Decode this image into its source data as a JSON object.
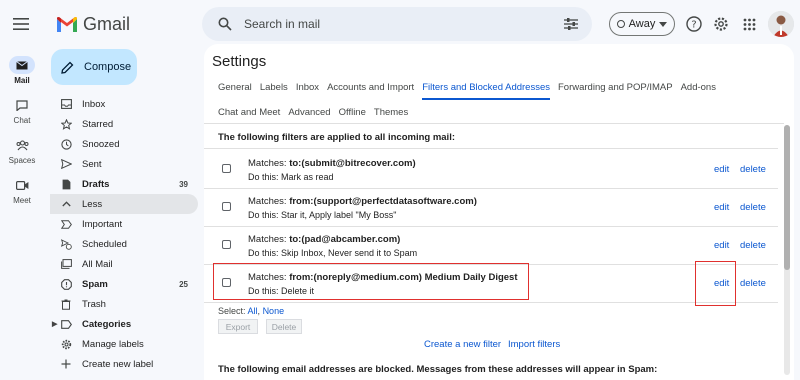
{
  "header": {
    "brand": "Gmail",
    "search_placeholder": "Search in mail",
    "status": "Away"
  },
  "rail": [
    {
      "label": "Mail",
      "icon": "mail-icon"
    },
    {
      "label": "Chat",
      "icon": "chat-icon"
    },
    {
      "label": "Spaces",
      "icon": "spaces-icon"
    },
    {
      "label": "Meet",
      "icon": "meet-icon"
    }
  ],
  "compose_label": "Compose",
  "folders": [
    {
      "label": "Inbox",
      "count": "",
      "icon": "inbox-icon"
    },
    {
      "label": "Starred",
      "count": "",
      "icon": "star-icon"
    },
    {
      "label": "Snoozed",
      "count": "",
      "icon": "clock-icon"
    },
    {
      "label": "Sent",
      "count": "",
      "icon": "send-icon"
    },
    {
      "label": "Drafts",
      "count": "39",
      "icon": "draft-icon"
    },
    {
      "label": "Less",
      "count": "",
      "icon": "chevron-up-icon"
    },
    {
      "label": "Important",
      "count": "",
      "icon": "important-icon"
    },
    {
      "label": "Scheduled",
      "count": "",
      "icon": "scheduled-icon"
    },
    {
      "label": "All Mail",
      "count": "",
      "icon": "all-mail-icon"
    },
    {
      "label": "Spam",
      "count": "25",
      "icon": "spam-icon"
    },
    {
      "label": "Trash",
      "count": "",
      "icon": "trash-icon"
    },
    {
      "label": "Categories",
      "count": "",
      "icon": "label-icon"
    },
    {
      "label": "Manage labels",
      "count": "",
      "icon": "gear-icon"
    },
    {
      "label": "Create new label",
      "count": "",
      "icon": "plus-icon"
    }
  ],
  "settings": {
    "title": "Settings",
    "tabs_row1": [
      "General",
      "Labels",
      "Inbox",
      "Accounts and Import",
      "Filters and Blocked Addresses",
      "Forwarding and POP/IMAP",
      "Add-ons"
    ],
    "tabs_row2": [
      "Chat and Meet",
      "Advanced",
      "Offline",
      "Themes"
    ],
    "active_tab": "Filters and Blocked Addresses",
    "filters_heading": "The following filters are applied to all incoming mail:",
    "filters": [
      {
        "matches_label": "Matches: ",
        "criteria": "to:(submit@bitrecover.com)",
        "action": "Do this: Mark as read",
        "edit": "edit",
        "delete": "delete"
      },
      {
        "matches_label": "Matches: ",
        "criteria": "from:(support@perfectdatasoftware.com)",
        "action": "Do this: Star it, Apply label \"My Boss\"",
        "edit": "edit",
        "delete": "delete"
      },
      {
        "matches_label": "Matches: ",
        "criteria": "to:(pad@abcamber.com)",
        "action": "Do this: Skip Inbox, Never send it to Spam",
        "edit": "edit",
        "delete": "delete"
      },
      {
        "matches_label": "Matches: ",
        "criteria": "from:(noreply@medium.com) Medium Daily Digest",
        "action": "Do this: Delete it",
        "edit": "edit",
        "delete": "delete"
      }
    ],
    "select_label": "Select: ",
    "select_all": "All",
    "select_sep": ", ",
    "select_none": "None",
    "export_label": "Export",
    "delete_label": "Delete",
    "create_filter": "Create a new filter",
    "import_filters": "Import filters",
    "blocked_heading": "The following email addresses are blocked. Messages from these addresses will appear in Spam:"
  },
  "colors": {
    "accent": "#0b57d0",
    "highlight": "#e0302e",
    "compose_bg": "#c2e7ff"
  }
}
